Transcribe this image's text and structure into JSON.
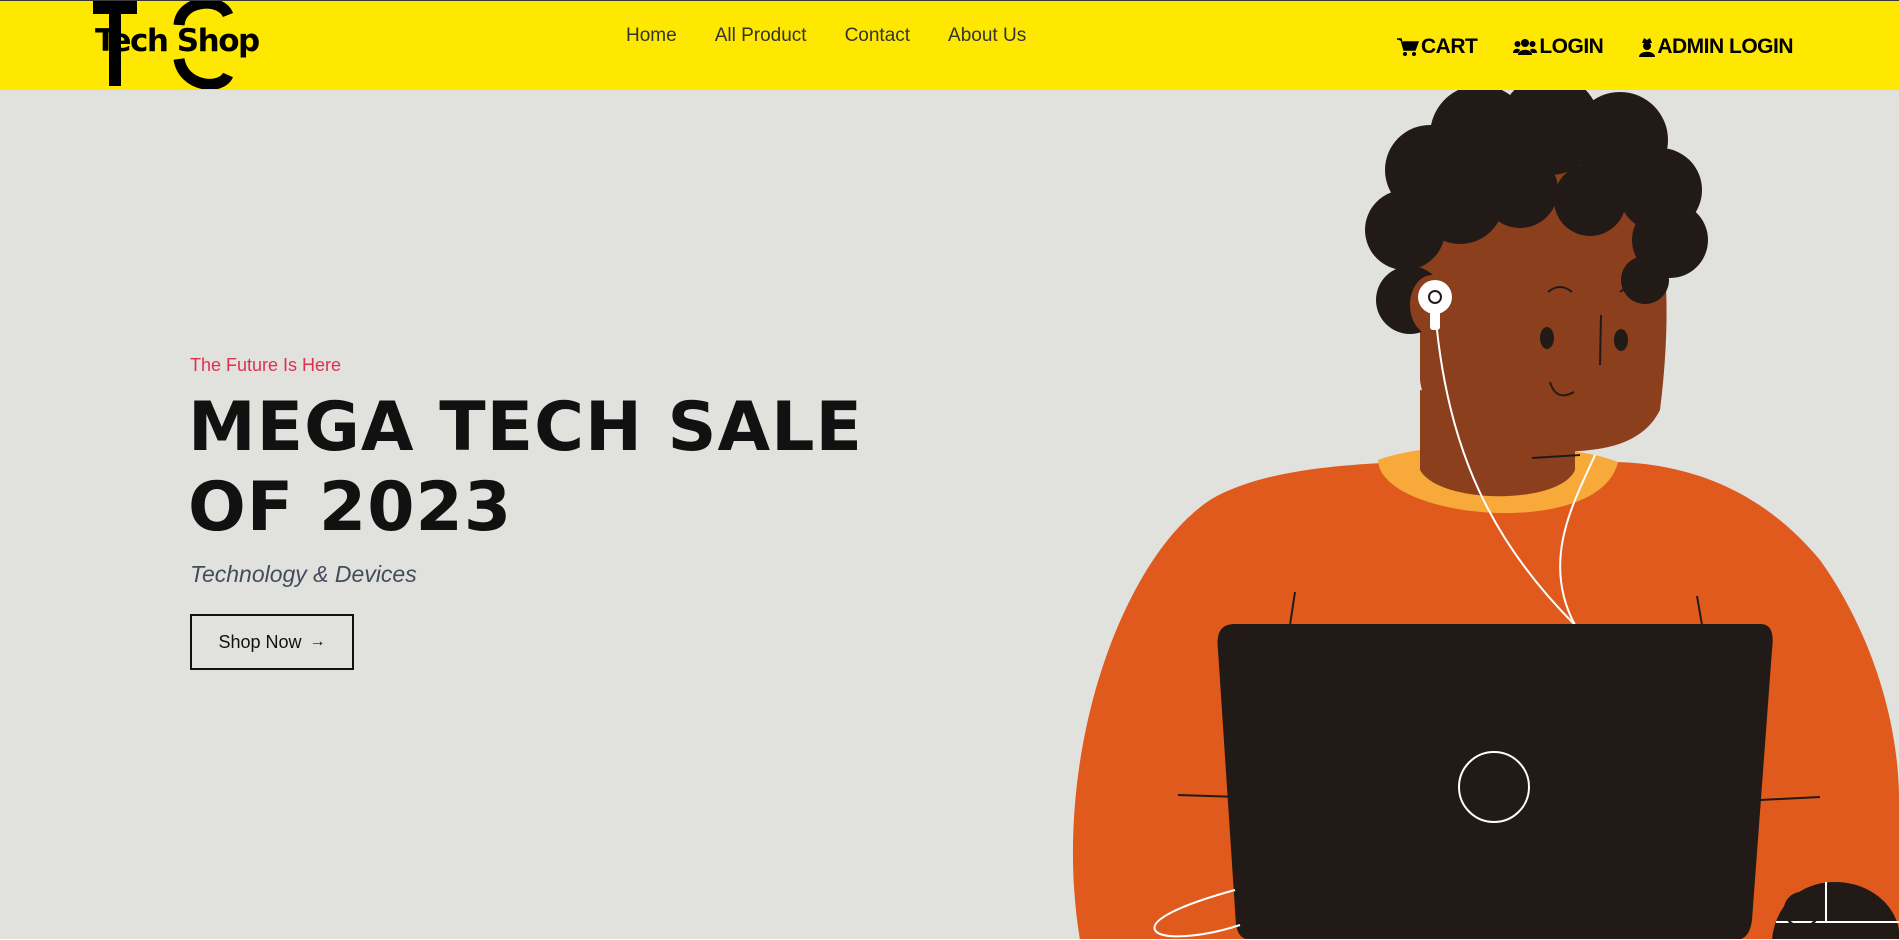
{
  "brand": {
    "logo_text": "Tech Shop",
    "color": "#ffe800"
  },
  "nav": {
    "links": [
      "Home",
      "All Product",
      "Contact",
      "About Us"
    ],
    "actions": [
      {
        "label": "CART",
        "icon": "cart-icon"
      },
      {
        "label": "LOGIN",
        "icon": "users-icon"
      },
      {
        "label": "ADMIN LOGIN",
        "icon": "user-secret-icon"
      }
    ]
  },
  "hero": {
    "tagline": "The Future Is Here",
    "headline_line1": "MEGA TECH SALE",
    "headline_line2": "OF 2023",
    "subtitle": "Technology & Devices",
    "cta_label": "Shop Now",
    "cta_icon": "arrow-right-icon",
    "scroll_icon": "arrow-down-circle-icon"
  },
  "colors": {
    "accent_red": "#e0304f",
    "hero_bg": "#e1e1de",
    "sweater": "#e05a1e",
    "skin": "#8c3f1c",
    "laptop": "#221a16"
  }
}
